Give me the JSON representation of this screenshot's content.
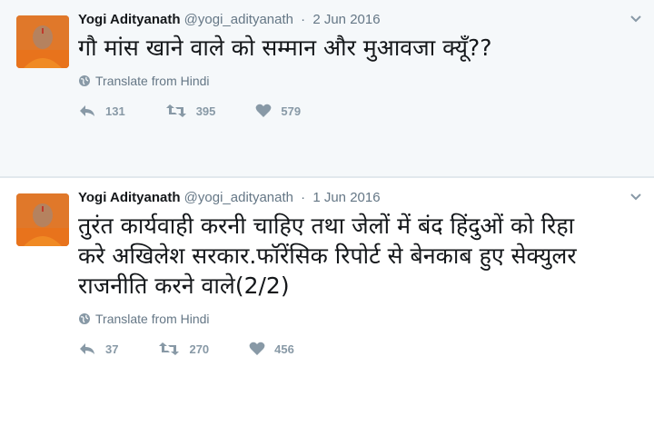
{
  "tweets": [
    {
      "name": "Yogi Adityanath",
      "handle": "@yogi_adityanath",
      "separator": "·",
      "date": "2 Jun 2016",
      "text": "गौ मांस खाने वाले को सम्मान और मुआवजा क्यूँ??",
      "translate": "Translate from Hindi",
      "replies": "131",
      "retweets": "395",
      "likes": "579"
    },
    {
      "name": "Yogi Adityanath",
      "handle": "@yogi_adityanath",
      "separator": "·",
      "date": "1 Jun 2016",
      "text": "तुरंत कार्यवाही करनी चाहिए तथा जेलों में बंद हिंदुओं को रिहा करे अखिलेश सरकार.फॉरेंसिक रिपोर्ट से बेनकाब हुए सेक्युलर राजनीति करने वाले(2/2)",
      "translate": "Translate from Hindi",
      "replies": "37",
      "retweets": "270",
      "likes": "456"
    }
  ],
  "icons": {
    "avatar": "profile-photo",
    "caret": "chevron-down-icon",
    "translate": "globe-icon",
    "reply": "reply-icon",
    "retweet": "retweet-icon",
    "like": "heart-icon"
  },
  "colors": {
    "background_first": "#f5f8fa",
    "muted": "#657786",
    "icon": "#8899a6"
  }
}
